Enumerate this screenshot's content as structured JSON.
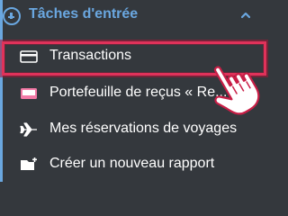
{
  "section": {
    "title": "Tâches d'entrée",
    "expand_icon": "chevron-up-icon",
    "add_icon": "plus-circle-icon"
  },
  "items": [
    {
      "label": "Transactions",
      "icon": "credit-card-icon"
    },
    {
      "label": "Portefeuille de reçus « Re...",
      "icon": "receipt-wallet-icon"
    },
    {
      "label": "Mes réservations de voyages",
      "icon": "airplane-icon"
    },
    {
      "label": "Créer un nouveau rapport",
      "icon": "add-report-icon"
    }
  ],
  "colors": {
    "background": "#34383d",
    "accent": "#6aa7e0",
    "highlight": "#e0325a",
    "text": "#ffffff",
    "wallet_pink": "#f27aa6"
  }
}
